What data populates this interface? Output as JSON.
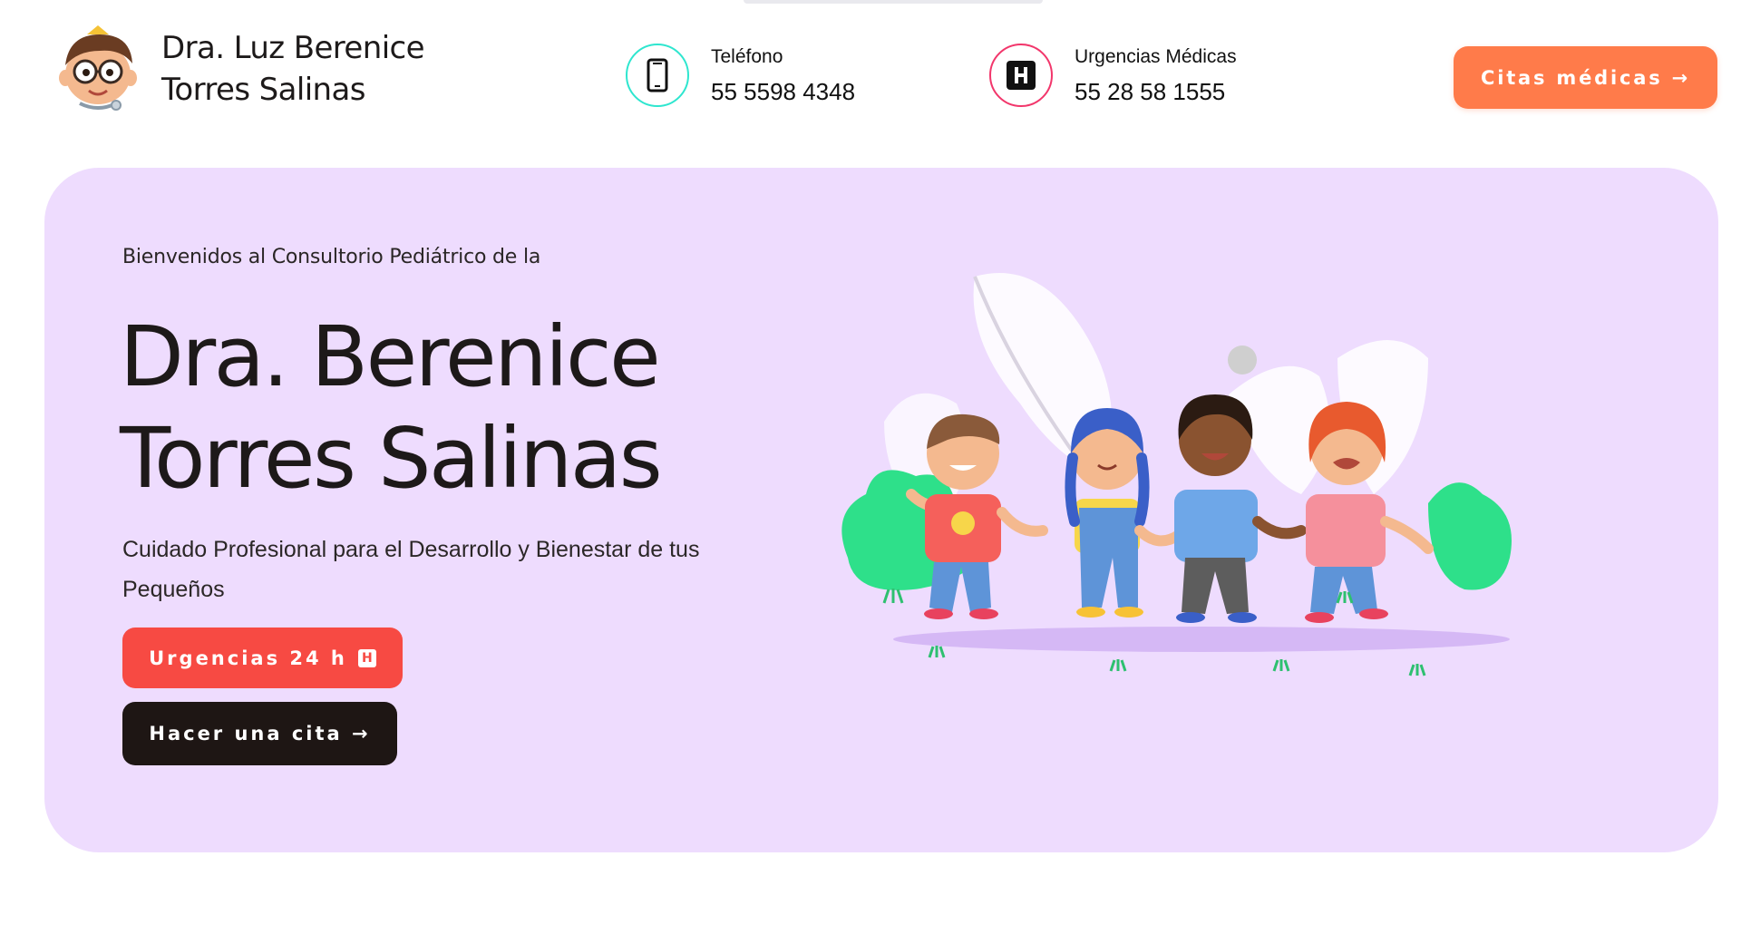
{
  "header": {
    "brand_line1": "Dra. Luz Berenice",
    "brand_line2": "Torres Salinas",
    "phone_label": "Teléfono",
    "phone_value": "55 5598 4348",
    "urgent_label": "Urgencias Médicas",
    "urgent_value": "55 28 58 1555",
    "cta_label": "Citas médicas →"
  },
  "hero": {
    "welcome": "Bienvenidos al Consultorio Pediátrico de la",
    "title_line1": "Dra. Berenice",
    "title_line2": "Torres Salinas",
    "subtitle": "Cuidado Profesional para el Desarrollo y Bienestar de tus Pequeños",
    "btn_urgent": "Urgencias 24 h",
    "btn_urgent_badge": "H",
    "btn_appointment": "Hacer una cita →"
  },
  "icons": {
    "logo": "doctor-mascot-logo",
    "phone": "smartphone-icon",
    "hospital": "hospital-icon"
  },
  "colors": {
    "accent_orange": "#ff7b4a",
    "hero_bg": "#eedcfe",
    "urgent_red": "#f74a43",
    "dark": "#1e1614",
    "teal_ring": "#2ee6cf",
    "pink_ring": "#f2366b"
  }
}
